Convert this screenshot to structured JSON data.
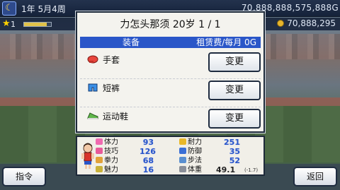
{
  "top": {
    "date": "1年 5月4周",
    "money_top": "70,888,888,575,888G",
    "level": "1",
    "level_progress": 0.85,
    "money_bottom": "70,888,295"
  },
  "dialog": {
    "title": "力怎头那须 20岁 1 / 1",
    "header_left": "装备",
    "header_right": "租赁费/每月 0G",
    "equipment": [
      {
        "name": "手套",
        "icon": "glove-icon",
        "color": "#e8453c",
        "button": "变更"
      },
      {
        "name": "短裤",
        "icon": "shorts-icon",
        "color": "#3a8fe6",
        "button": "变更"
      },
      {
        "name": "运动鞋",
        "icon": "sneaker-icon",
        "color": "#5fb64a",
        "button": "变更"
      }
    ]
  },
  "stats": {
    "left": [
      {
        "name": "体力",
        "value": "93",
        "icon": "heart-icon",
        "color": "#f06ab0"
      },
      {
        "name": "技巧",
        "value": "126",
        "icon": "flower-icon",
        "color": "#e85a9a"
      },
      {
        "name": "拳力",
        "value": "68",
        "icon": "fist-icon",
        "color": "#e2a23a"
      },
      {
        "name": "魅力",
        "value": "16",
        "icon": "charm-icon",
        "color": "#c9b23a"
      }
    ],
    "right": [
      {
        "name": "耐力",
        "value": "251",
        "icon": "bolt-icon",
        "color": "#e8b82a"
      },
      {
        "name": "防御",
        "value": "35",
        "icon": "shield-icon",
        "color": "#3a6fd6"
      },
      {
        "name": "步法",
        "value": "52",
        "icon": "footstep-icon",
        "color": "#5a8fd0"
      }
    ],
    "weight_label": "体重",
    "weight_value": "49.1",
    "weight_delta": "(-1.7)"
  },
  "buttons": {
    "command": "指令",
    "back": "返回"
  }
}
